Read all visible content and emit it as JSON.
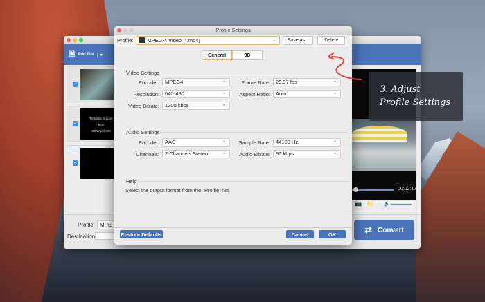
{
  "main_window": {
    "toolbar": {
      "add_file": "Add File"
    },
    "files": [
      {
        "line1": "",
        "line2": "",
        "line3": ""
      },
      {
        "line1": "Trafalgar Square",
        "line2": "6pm",
        "line3": "30th April 200"
      },
      {
        "line1": "",
        "line2": "",
        "line3": ""
      }
    ],
    "profile_label": "Profile:",
    "profile_value": "MPE",
    "destination_label": "Destination:",
    "time": "00:02:17",
    "convert": "Convert"
  },
  "dialog": {
    "title": "Profile Settings",
    "profile_label": "Profile:",
    "profile_value": "MPEG-4 Video (*.mp4)",
    "save_as": "Save as...",
    "delete": "Delete",
    "tabs": [
      "General",
      "3D"
    ],
    "video": {
      "heading": "Video Settings",
      "encoder_label": "Encoder:",
      "encoder": "MPEG4",
      "resolution_label": "Resolution:",
      "resolution": "640*480",
      "bitrate_label": "Video Bitrate:",
      "bitrate": "1200 kbps",
      "frame_rate_label": "Frame Rate:",
      "frame_rate": "29.97 fps",
      "aspect_label": "Aspect Ratio:",
      "aspect": "Auto"
    },
    "audio": {
      "heading": "Audio Settings",
      "encoder_label": "Encoder:",
      "encoder": "AAC",
      "channels_label": "Channels:",
      "channels": "2 Channels Stereo",
      "sample_label": "Sample Rate:",
      "sample": "44100 Hz",
      "bitrate_label": "Audio Bitrate:",
      "bitrate": "96 kbps"
    },
    "help": {
      "heading": "Help",
      "text": "Select the output format from the \"Profile\" list."
    },
    "restore": "Restore Defaults",
    "cancel": "Cancel",
    "ok": "OK"
  },
  "annotation": {
    "line1": "3. Adjust",
    "line2": "Profile Settings"
  },
  "colors": {
    "accent": "#4a73b9",
    "arrow": "#e0443e"
  }
}
